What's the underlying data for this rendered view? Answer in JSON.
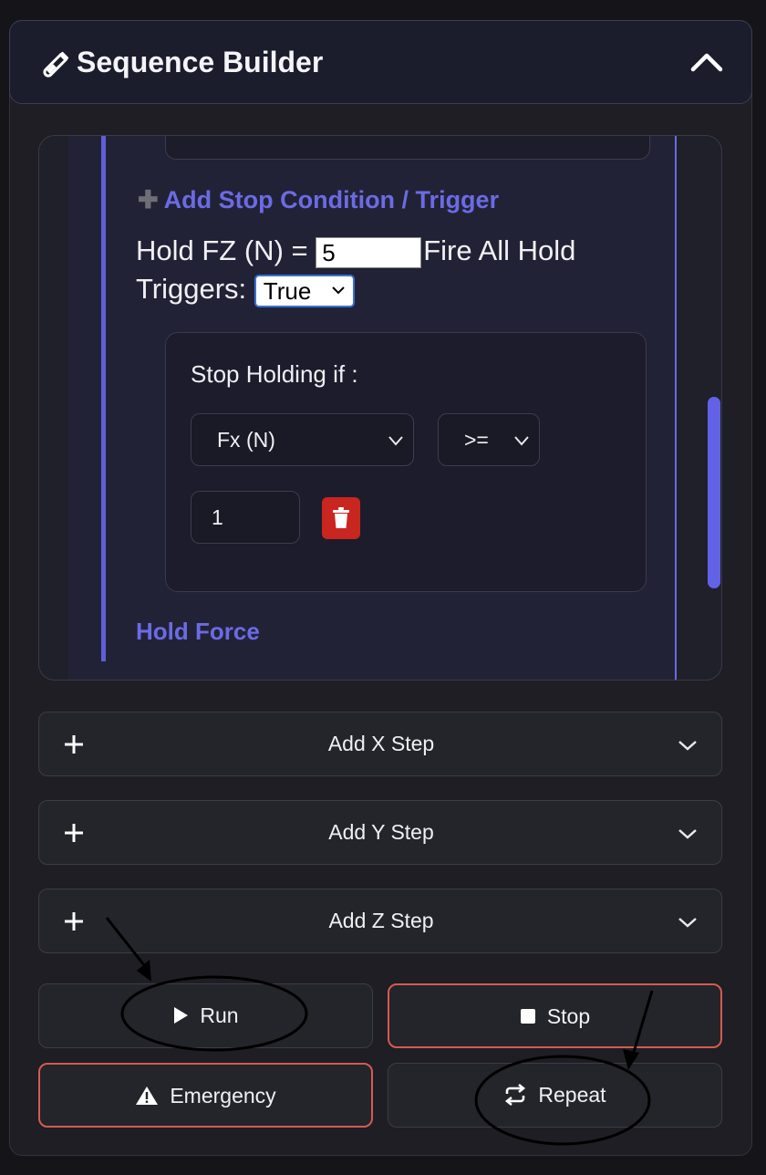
{
  "header": {
    "title": "Sequence Builder",
    "icon": "test-tube-icon",
    "collapse_icon": "chevron-up-icon"
  },
  "step": {
    "add_trigger_label": "Add Stop Condition / Trigger",
    "hold_prefix": "Hold FZ (N) =",
    "hold_value": "5",
    "fire_all_label": "Fire All Hold Triggers:",
    "fire_all_value": "True",
    "stop_condition": {
      "label": "Stop Holding if :",
      "field": "Fx (N)",
      "operator": ">=",
      "value": "1"
    },
    "footer_label": "Hold Force"
  },
  "add_steps": [
    {
      "label": "Add X Step"
    },
    {
      "label": "Add Y Step"
    },
    {
      "label": "Add Z Step"
    }
  ],
  "actions": {
    "run": "Run",
    "stop": "Stop",
    "emergency": "Emergency",
    "repeat": "Repeat"
  },
  "colors": {
    "accent": "#6b6be6",
    "danger_border": "#d65a50",
    "trash": "#c9261f"
  }
}
